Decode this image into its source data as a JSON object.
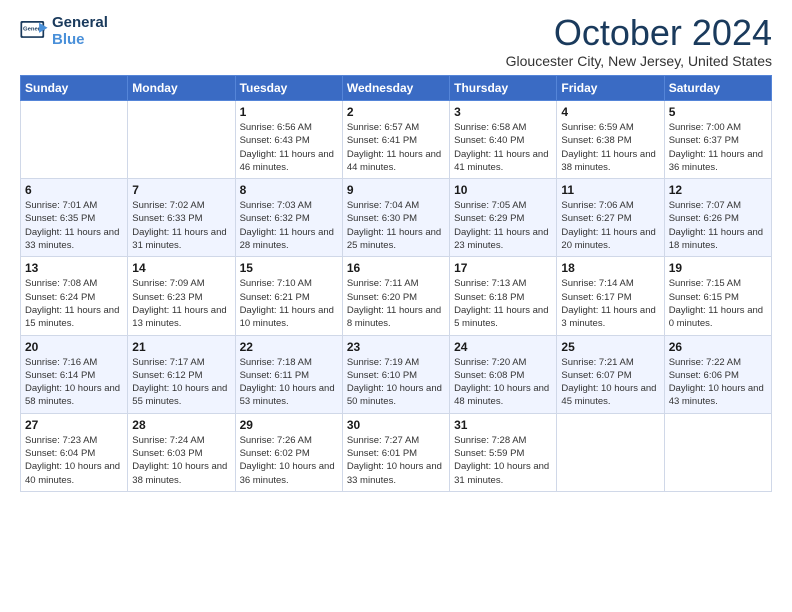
{
  "header": {
    "logo_line1": "General",
    "logo_line2": "Blue",
    "title": "October 2024",
    "location": "Gloucester City, New Jersey, United States"
  },
  "weekdays": [
    "Sunday",
    "Monday",
    "Tuesday",
    "Wednesday",
    "Thursday",
    "Friday",
    "Saturday"
  ],
  "weeks": [
    [
      {
        "day": "",
        "info": ""
      },
      {
        "day": "",
        "info": ""
      },
      {
        "day": "1",
        "info": "Sunrise: 6:56 AM\nSunset: 6:43 PM\nDaylight: 11 hours and 46 minutes."
      },
      {
        "day": "2",
        "info": "Sunrise: 6:57 AM\nSunset: 6:41 PM\nDaylight: 11 hours and 44 minutes."
      },
      {
        "day": "3",
        "info": "Sunrise: 6:58 AM\nSunset: 6:40 PM\nDaylight: 11 hours and 41 minutes."
      },
      {
        "day": "4",
        "info": "Sunrise: 6:59 AM\nSunset: 6:38 PM\nDaylight: 11 hours and 38 minutes."
      },
      {
        "day": "5",
        "info": "Sunrise: 7:00 AM\nSunset: 6:37 PM\nDaylight: 11 hours and 36 minutes."
      }
    ],
    [
      {
        "day": "6",
        "info": "Sunrise: 7:01 AM\nSunset: 6:35 PM\nDaylight: 11 hours and 33 minutes."
      },
      {
        "day": "7",
        "info": "Sunrise: 7:02 AM\nSunset: 6:33 PM\nDaylight: 11 hours and 31 minutes."
      },
      {
        "day": "8",
        "info": "Sunrise: 7:03 AM\nSunset: 6:32 PM\nDaylight: 11 hours and 28 minutes."
      },
      {
        "day": "9",
        "info": "Sunrise: 7:04 AM\nSunset: 6:30 PM\nDaylight: 11 hours and 25 minutes."
      },
      {
        "day": "10",
        "info": "Sunrise: 7:05 AM\nSunset: 6:29 PM\nDaylight: 11 hours and 23 minutes."
      },
      {
        "day": "11",
        "info": "Sunrise: 7:06 AM\nSunset: 6:27 PM\nDaylight: 11 hours and 20 minutes."
      },
      {
        "day": "12",
        "info": "Sunrise: 7:07 AM\nSunset: 6:26 PM\nDaylight: 11 hours and 18 minutes."
      }
    ],
    [
      {
        "day": "13",
        "info": "Sunrise: 7:08 AM\nSunset: 6:24 PM\nDaylight: 11 hours and 15 minutes."
      },
      {
        "day": "14",
        "info": "Sunrise: 7:09 AM\nSunset: 6:23 PM\nDaylight: 11 hours and 13 minutes."
      },
      {
        "day": "15",
        "info": "Sunrise: 7:10 AM\nSunset: 6:21 PM\nDaylight: 11 hours and 10 minutes."
      },
      {
        "day": "16",
        "info": "Sunrise: 7:11 AM\nSunset: 6:20 PM\nDaylight: 11 hours and 8 minutes."
      },
      {
        "day": "17",
        "info": "Sunrise: 7:13 AM\nSunset: 6:18 PM\nDaylight: 11 hours and 5 minutes."
      },
      {
        "day": "18",
        "info": "Sunrise: 7:14 AM\nSunset: 6:17 PM\nDaylight: 11 hours and 3 minutes."
      },
      {
        "day": "19",
        "info": "Sunrise: 7:15 AM\nSunset: 6:15 PM\nDaylight: 11 hours and 0 minutes."
      }
    ],
    [
      {
        "day": "20",
        "info": "Sunrise: 7:16 AM\nSunset: 6:14 PM\nDaylight: 10 hours and 58 minutes."
      },
      {
        "day": "21",
        "info": "Sunrise: 7:17 AM\nSunset: 6:12 PM\nDaylight: 10 hours and 55 minutes."
      },
      {
        "day": "22",
        "info": "Sunrise: 7:18 AM\nSunset: 6:11 PM\nDaylight: 10 hours and 53 minutes."
      },
      {
        "day": "23",
        "info": "Sunrise: 7:19 AM\nSunset: 6:10 PM\nDaylight: 10 hours and 50 minutes."
      },
      {
        "day": "24",
        "info": "Sunrise: 7:20 AM\nSunset: 6:08 PM\nDaylight: 10 hours and 48 minutes."
      },
      {
        "day": "25",
        "info": "Sunrise: 7:21 AM\nSunset: 6:07 PM\nDaylight: 10 hours and 45 minutes."
      },
      {
        "day": "26",
        "info": "Sunrise: 7:22 AM\nSunset: 6:06 PM\nDaylight: 10 hours and 43 minutes."
      }
    ],
    [
      {
        "day": "27",
        "info": "Sunrise: 7:23 AM\nSunset: 6:04 PM\nDaylight: 10 hours and 40 minutes."
      },
      {
        "day": "28",
        "info": "Sunrise: 7:24 AM\nSunset: 6:03 PM\nDaylight: 10 hours and 38 minutes."
      },
      {
        "day": "29",
        "info": "Sunrise: 7:26 AM\nSunset: 6:02 PM\nDaylight: 10 hours and 36 minutes."
      },
      {
        "day": "30",
        "info": "Sunrise: 7:27 AM\nSunset: 6:01 PM\nDaylight: 10 hours and 33 minutes."
      },
      {
        "day": "31",
        "info": "Sunrise: 7:28 AM\nSunset: 5:59 PM\nDaylight: 10 hours and 31 minutes."
      },
      {
        "day": "",
        "info": ""
      },
      {
        "day": "",
        "info": ""
      }
    ]
  ]
}
